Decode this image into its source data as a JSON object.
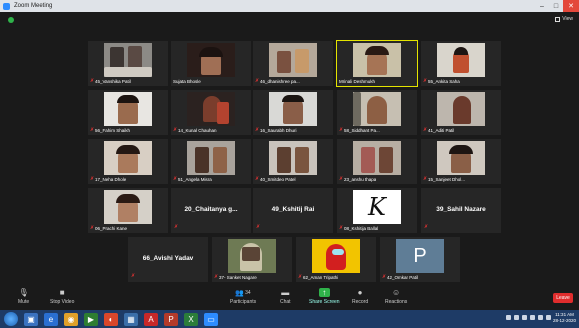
{
  "window": {
    "title": "Zoom Meeting",
    "view_label": "View"
  },
  "row1": [
    {
      "name": "45_Vanshika Patil",
      "muted": true
    },
    {
      "name": "Sujata Bhosle",
      "muted": false
    },
    {
      "name": "46_dhanishree pa...",
      "muted": true
    },
    {
      "name": "Mrinali Deshmukh",
      "muted": false
    },
    {
      "name": "55_Ankita Saha",
      "muted": true
    }
  ],
  "row2": [
    {
      "name": "56_Fahim Shaikh",
      "muted": true
    },
    {
      "name": "14_Kunal Chauhan",
      "muted": true
    },
    {
      "name": "16_Saurabh Dhuri",
      "muted": true
    },
    {
      "name": "58_Siddhant Pa...",
      "muted": true
    },
    {
      "name": "41_Aditi Patil",
      "muted": true
    }
  ],
  "row3": [
    {
      "name": "17_Neha Dhole",
      "muted": true
    },
    {
      "name": "51_Angela Misra",
      "muted": true
    },
    {
      "name": "40_Smitdeo Patel",
      "muted": true
    },
    {
      "name": "23_anshu thapa",
      "muted": true
    },
    {
      "name": "15_Sanjeet Dhol...",
      "muted": true
    }
  ],
  "row4": [
    {
      "name": "06_Prachi Kane",
      "muted": true
    },
    {
      "name": "20_Chaitanya g...",
      "muted": true
    },
    {
      "name": "49_Kshitij Rai",
      "muted": true
    },
    {
      "name": "08_Kshitija Ballal",
      "muted": true
    },
    {
      "name": "39_Sahil Nazare",
      "muted": true
    }
  ],
  "row5": [
    {
      "name": "66_Avishi Yadav",
      "muted": true
    },
    {
      "name": "37- Sanket Nagare",
      "muted": true
    },
    {
      "name": "62_Aman Tripathi",
      "muted": true
    },
    {
      "name": "42_Omkar Patil",
      "muted": true
    }
  ],
  "tile_letters": {
    "kshitija": "K",
    "omkar": "P"
  },
  "toolbar": {
    "mute": "Mute",
    "stop_video": "Stop Video",
    "participants": "Participants",
    "participants_count": "34",
    "chat": "Chat",
    "share_screen": "Share Screen",
    "record": "Record",
    "reactions": "Reactions",
    "leave": "Leave"
  },
  "clock": {
    "time": "11:31 AM",
    "date": "28-12-2020"
  },
  "colors": {
    "active_border": "#e4e400",
    "share_green": "#2fb34a",
    "leave_red": "#e02d2d",
    "taskbar": "#1e3b66"
  }
}
